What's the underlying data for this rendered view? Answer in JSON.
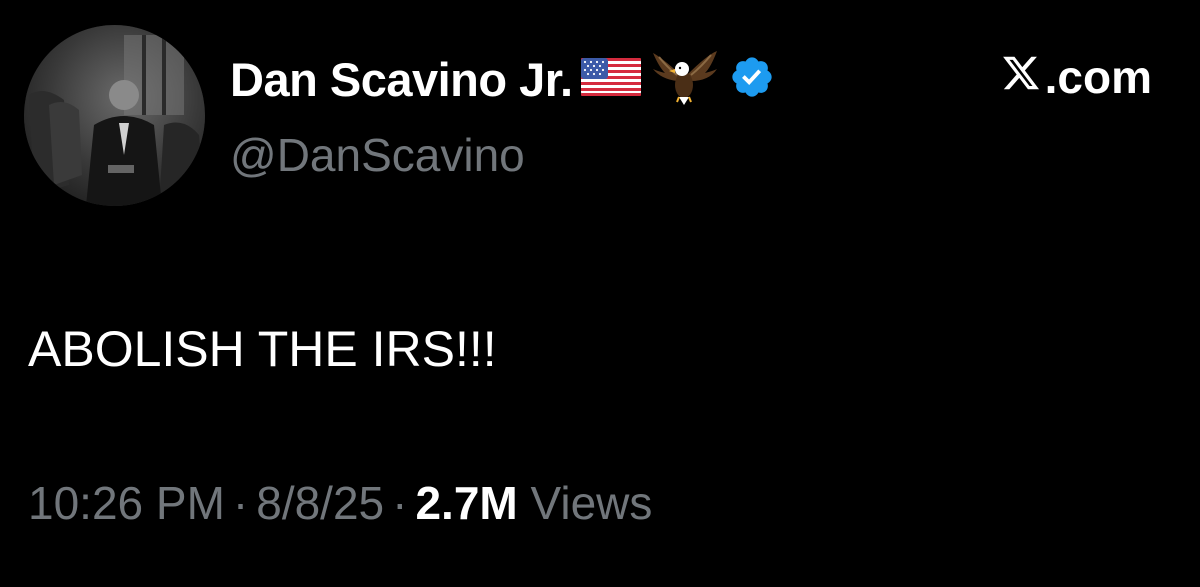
{
  "author": {
    "display_name": "Dan Scavino Jr.",
    "handle": "@DanScavino",
    "badges": [
      "us-flag-icon",
      "eagle-icon",
      "verified-icon"
    ],
    "verified_color": "#1d9bf0"
  },
  "site": {
    "label": ".com",
    "icon": "x-logo-icon"
  },
  "tweet": {
    "text": "ABOLISH THE IRS!!!"
  },
  "meta": {
    "time": "10:26 PM",
    "separator": "·",
    "date": "8/8/25",
    "views_count": "2.7M",
    "views_label": "Views"
  },
  "colors": {
    "background": "#000000",
    "primary_text": "#ffffff",
    "secondary_text": "#71767b"
  }
}
